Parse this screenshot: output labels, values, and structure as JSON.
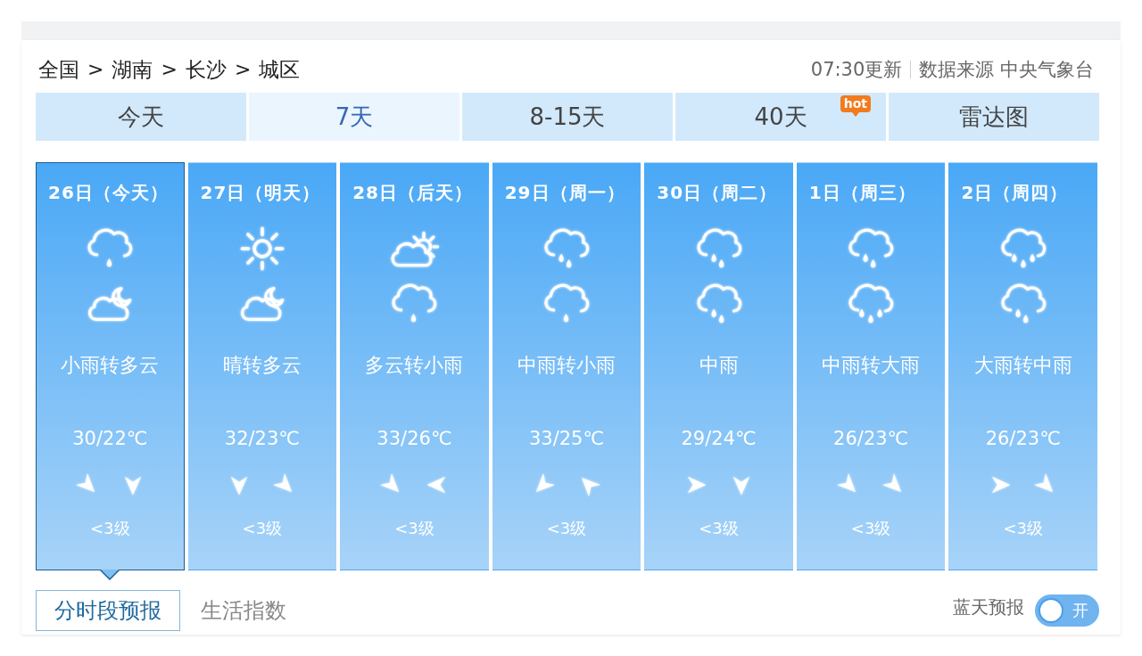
{
  "breadcrumb": [
    {
      "kind": "place",
      "text": "全国"
    },
    {
      "kind": "separator",
      "text": ">"
    },
    {
      "kind": "place",
      "text": "湖南"
    },
    {
      "kind": "separator",
      "text": ">"
    },
    {
      "kind": "place",
      "text": "长沙"
    },
    {
      "kind": "separator",
      "text": ">"
    },
    {
      "kind": "place",
      "text": "城区"
    }
  ],
  "update_time": "07:30更新",
  "source": "数据来源 中央气象台",
  "tabs": [
    {
      "label": "今天",
      "selected": false
    },
    {
      "label": "7天",
      "selected": true
    },
    {
      "label": "8-15天",
      "selected": false
    },
    {
      "label": "40天",
      "selected": false,
      "badge": "hot"
    },
    {
      "label": "雷达图",
      "selected": false
    }
  ],
  "days": [
    {
      "date": "26日（今天）",
      "selected": true,
      "icons": [
        {
          "kind": "light-rain"
        },
        {
          "kind": "cloud-moon"
        }
      ],
      "weather": "小雨转多云",
      "temperature": "30/22℃",
      "winds": [
        {
          "kind": "se"
        },
        {
          "kind": "s"
        }
      ],
      "wind_level": "<3级"
    },
    {
      "date": "27日（明天）",
      "selected": false,
      "icons": [
        {
          "kind": "sun"
        },
        {
          "kind": "cloud-moon"
        }
      ],
      "weather": "晴转多云",
      "temperature": "32/23℃",
      "winds": [
        {
          "kind": "s"
        },
        {
          "kind": "se"
        }
      ],
      "wind_level": "<3级"
    },
    {
      "date": "28日（后天）",
      "selected": false,
      "icons": [
        {
          "kind": "cloud-sun"
        },
        {
          "kind": "light-rain"
        }
      ],
      "weather": "多云转小雨",
      "temperature": "33/26℃",
      "winds": [
        {
          "kind": "se"
        },
        {
          "kind": "w"
        }
      ],
      "wind_level": "<3级"
    },
    {
      "date": "29日（周一）",
      "selected": false,
      "icons": [
        {
          "kind": "moderate-rain"
        },
        {
          "kind": "light-rain"
        }
      ],
      "weather": "中雨转小雨",
      "temperature": "33/25℃",
      "winds": [
        {
          "kind": "sw"
        },
        {
          "kind": "nw"
        }
      ],
      "wind_level": "<3级"
    },
    {
      "date": "30日（周二）",
      "selected": false,
      "icons": [
        {
          "kind": "moderate-rain"
        },
        {
          "kind": "moderate-rain"
        }
      ],
      "weather": "中雨",
      "temperature": "29/24℃",
      "winds": [
        {
          "kind": "e"
        },
        {
          "kind": "s"
        }
      ],
      "wind_level": "<3级"
    },
    {
      "date": "1日（周三）",
      "selected": false,
      "icons": [
        {
          "kind": "moderate-rain"
        },
        {
          "kind": "heavy-rain"
        }
      ],
      "weather": "中雨转大雨",
      "temperature": "26/23℃",
      "winds": [
        {
          "kind": "se"
        },
        {
          "kind": "se"
        }
      ],
      "wind_level": "<3级"
    },
    {
      "date": "2日（周四）",
      "selected": false,
      "icons": [
        {
          "kind": "heavy-rain"
        },
        {
          "kind": "moderate-rain"
        }
      ],
      "weather": "大雨转中雨",
      "temperature": "26/23℃",
      "winds": [
        {
          "kind": "e"
        },
        {
          "kind": "se"
        }
      ],
      "wind_level": "<3级"
    }
  ],
  "sub_tabs": [
    {
      "label": "分时段预报",
      "selected": true
    },
    {
      "label": "生活指数",
      "selected": false
    }
  ],
  "blue_sky": {
    "label": "蓝天预报",
    "toggle": "开",
    "on": false
  }
}
